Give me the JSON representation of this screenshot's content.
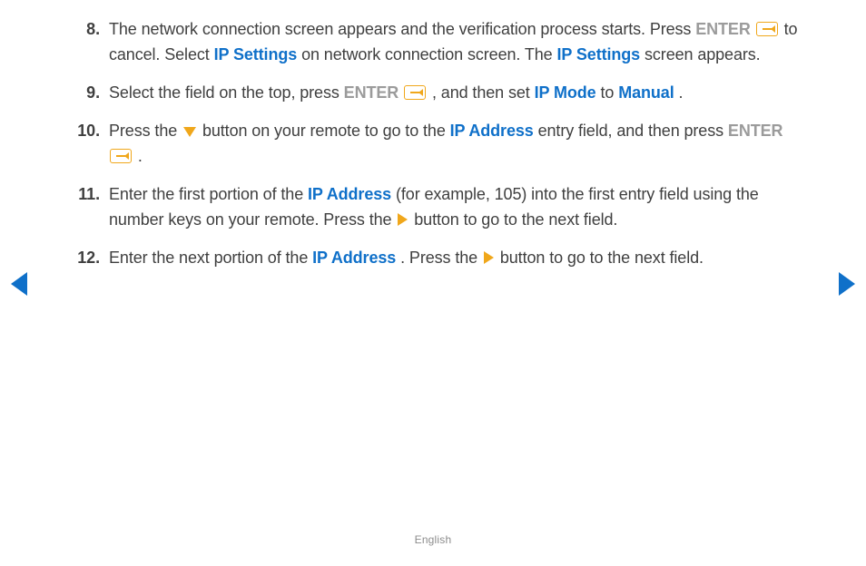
{
  "footer": {
    "language": "English"
  },
  "labels": {
    "enter": "ENTER",
    "ip_settings": "IP Settings",
    "ip_mode": "IP Mode",
    "manual": "Manual",
    "ip_address": "IP Address"
  },
  "steps": {
    "s8": {
      "a": "The network connection screen appears and the verification process starts. Press ",
      "b": " to cancel. Select ",
      "c": " on network connection screen. The ",
      "d": " screen appears."
    },
    "s9": {
      "a": "Select the field on the top, press ",
      "b": ", and then set ",
      "c": " to ",
      "d": "."
    },
    "s10": {
      "a": "Press the ",
      "b": " button on your remote to go to the ",
      "c": " entry field, and then press ",
      "d": "."
    },
    "s11": {
      "a": "Enter the first portion of the ",
      "b": " (for example, 105) into the first entry field using the number keys on your remote. Press the ",
      "c": " button to go to the next field."
    },
    "s12": {
      "a": "Enter the next portion of the ",
      "b": ". Press the ",
      "c": " button to go to the next field."
    }
  }
}
